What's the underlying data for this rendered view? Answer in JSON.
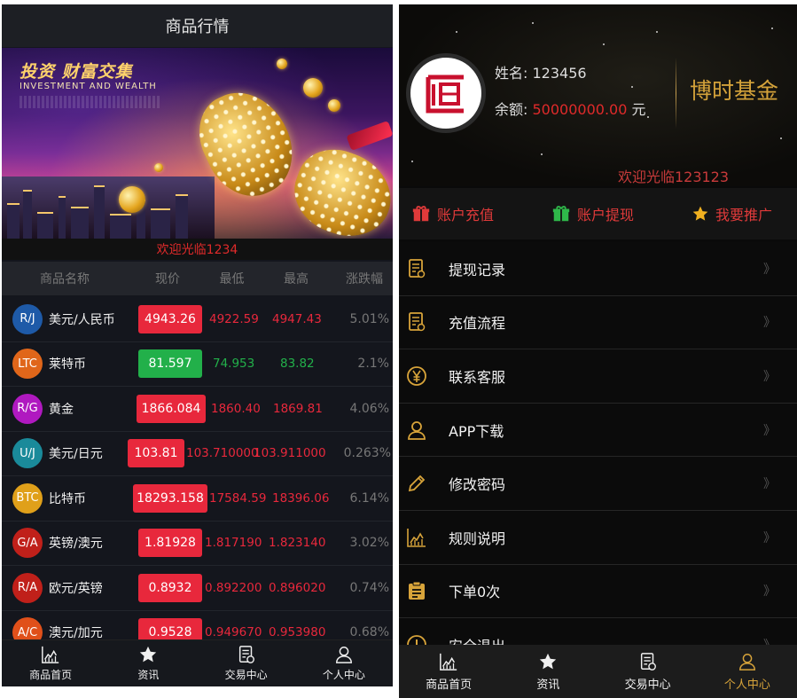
{
  "left": {
    "header_title": "商品行情",
    "banner": {
      "headline": "投资 财富交集",
      "subline": "INVESTMENT AND WEALTH"
    },
    "welcome": "欢迎光临1234",
    "columns": [
      "商品名称",
      "现价",
      "最低",
      "最高",
      "涨跌幅"
    ],
    "rows": [
      {
        "badge": "R/J",
        "badge_color": "#1e5aa8",
        "name": "美元/人民币",
        "now": "4943.26",
        "now_color": "#e8283c",
        "low": "4922.59",
        "high": "4947.43",
        "pct": "5.01%",
        "trend_color": "#e8283c"
      },
      {
        "badge": "LTC",
        "badge_color": "#e0661a",
        "name": "莱特币",
        "now": "81.597",
        "now_color": "#22b04a",
        "low": "74.953",
        "high": "83.82",
        "pct": "2.1%",
        "trend_color": "#22b04a"
      },
      {
        "badge": "R/G",
        "badge_color": "#b019c0",
        "name": "黄金",
        "now": "1866.084",
        "now_color": "#e8283c",
        "low": "1860.40",
        "high": "1869.81",
        "pct": "4.06%",
        "trend_color": "#e8283c"
      },
      {
        "badge": "U/J",
        "badge_color": "#1a8a9a",
        "name": "美元/日元",
        "now": "103.81",
        "now_color": "#e8283c",
        "low": "103.710000",
        "high": "103.911000",
        "pct": "0.263%",
        "trend_color": "#e8283c"
      },
      {
        "badge": "BTC",
        "badge_color": "#e0a01a",
        "name": "比特币",
        "now": "18293.158",
        "now_color": "#e8283c",
        "low": "17584.59",
        "high": "18396.06",
        "pct": "6.14%",
        "trend_color": "#e8283c"
      },
      {
        "badge": "G/A",
        "badge_color": "#c0201a",
        "name": "英镑/澳元",
        "now": "1.81928",
        "now_color": "#e8283c",
        "low": "1.817190",
        "high": "1.823140",
        "pct": "3.02%",
        "trend_color": "#e8283c"
      },
      {
        "badge": "R/A",
        "badge_color": "#c0201a",
        "name": "欧元/英镑",
        "now": "0.8932",
        "now_color": "#e8283c",
        "low": "0.892200",
        "high": "0.896020",
        "pct": "0.74%",
        "trend_color": "#e8283c"
      },
      {
        "badge": "A/C",
        "badge_color": "#e0501a",
        "name": "澳元/加元",
        "now": "0.9528",
        "now_color": "#e8283c",
        "low": "0.949670",
        "high": "0.953980",
        "pct": "0.68%",
        "trend_color": "#e8283c"
      }
    ],
    "tabs": [
      {
        "label": "商品首页",
        "icon": "chart-icon"
      },
      {
        "label": "资讯",
        "icon": "star-icon"
      },
      {
        "label": "交易中心",
        "icon": "document-icon"
      },
      {
        "label": "个人中心",
        "icon": "user-icon"
      }
    ]
  },
  "right": {
    "name_label": "姓名:",
    "name_value": "123456",
    "balance_label": "余额:",
    "balance_value": "50000000.00",
    "balance_unit": "元",
    "brand": "博时基金",
    "welcome": "欢迎光临123123",
    "actions": [
      {
        "label": "账户充值",
        "icon": "gift-icon",
        "icon_color": "#e03a3a"
      },
      {
        "label": "账户提现",
        "icon": "gift-icon",
        "icon_color": "#2fb84a"
      },
      {
        "label": "我要推广",
        "icon": "star-icon",
        "icon_color": "#f0b020"
      }
    ],
    "menu": [
      {
        "label": "提现记录",
        "icon": "document-icon"
      },
      {
        "label": "充值流程",
        "icon": "document-icon"
      },
      {
        "label": "联系客服",
        "icon": "yen-icon"
      },
      {
        "label": "APP下载",
        "icon": "user-icon"
      },
      {
        "label": "修改密码",
        "icon": "pencil-icon"
      },
      {
        "label": "规则说明",
        "icon": "chart-icon"
      },
      {
        "label": "下单0次",
        "icon": "clipboard-icon"
      },
      {
        "label": "安全退出",
        "icon": "power-icon"
      }
    ],
    "chevron": "》",
    "tabs": [
      {
        "label": "商品首页",
        "icon": "chart-icon"
      },
      {
        "label": "资讯",
        "icon": "star-icon"
      },
      {
        "label": "交易中心",
        "icon": "document-icon"
      },
      {
        "label": "个人中心",
        "icon": "user-icon",
        "active": true
      }
    ],
    "accent_color": "#d8a43a"
  }
}
